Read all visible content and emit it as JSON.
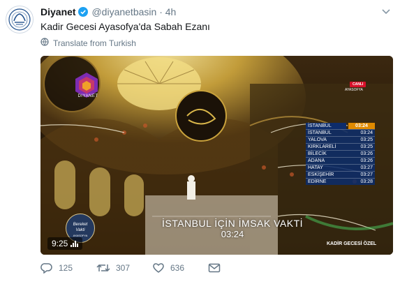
{
  "tweet": {
    "display_name": "Diyanet",
    "handle": "@diyanetbasin",
    "separator": "·",
    "time": "4h",
    "text": "Kadir Gecesi Ayasofya'da Sabah Ezanı",
    "translate_label": "Translate from Turkish",
    "icons": {
      "verified": "verified-badge-icon",
      "caret": "chevron-down-icon",
      "translate": "globe-icon"
    }
  },
  "video": {
    "channel_logo_text": "DIYANET",
    "live_label": "CANLI",
    "live_location": "AYASOFYA",
    "times_table": {
      "header_city": "İSTANBUL",
      "header_time": "03:24",
      "rows": [
        {
          "city": "İSTANBUL",
          "time": "03:24"
        },
        {
          "city": "YALOVA",
          "time": "03:25"
        },
        {
          "city": "KIRKLARELİ",
          "time": "03:25"
        },
        {
          "city": "BİLECİK",
          "time": "03:26"
        },
        {
          "city": "ADANA",
          "time": "03:26"
        },
        {
          "city": "HATAY",
          "time": "03:27"
        },
        {
          "city": "ESKİŞEHİR",
          "time": "03:27"
        },
        {
          "city": "EDİRNE",
          "time": "03:28"
        }
      ]
    },
    "overlay_title": "İSTANBUL İÇİN İMSAK VAKTİ",
    "overlay_time": "03:24",
    "program_badge": [
      "Bereket",
      "Vakti"
    ],
    "program_badge_sub": "AYASOFYA",
    "program_name": "KADİR GECESİ ÖZEL",
    "duration": "9:25",
    "colors": {
      "table_bg": "#0d2c6a",
      "time_highlight": "#e08a00",
      "live_red": "#d8102a",
      "dome_gold": "#d9b64a"
    }
  },
  "actions": {
    "reply_count": "125",
    "retweet_count": "307",
    "like_count": "636",
    "icons": [
      "reply-icon",
      "retweet-icon",
      "like-icon",
      "message-icon"
    ]
  },
  "colors": {
    "text": "#14171a",
    "secondary": "#657786",
    "verified": "#1da1f2"
  }
}
